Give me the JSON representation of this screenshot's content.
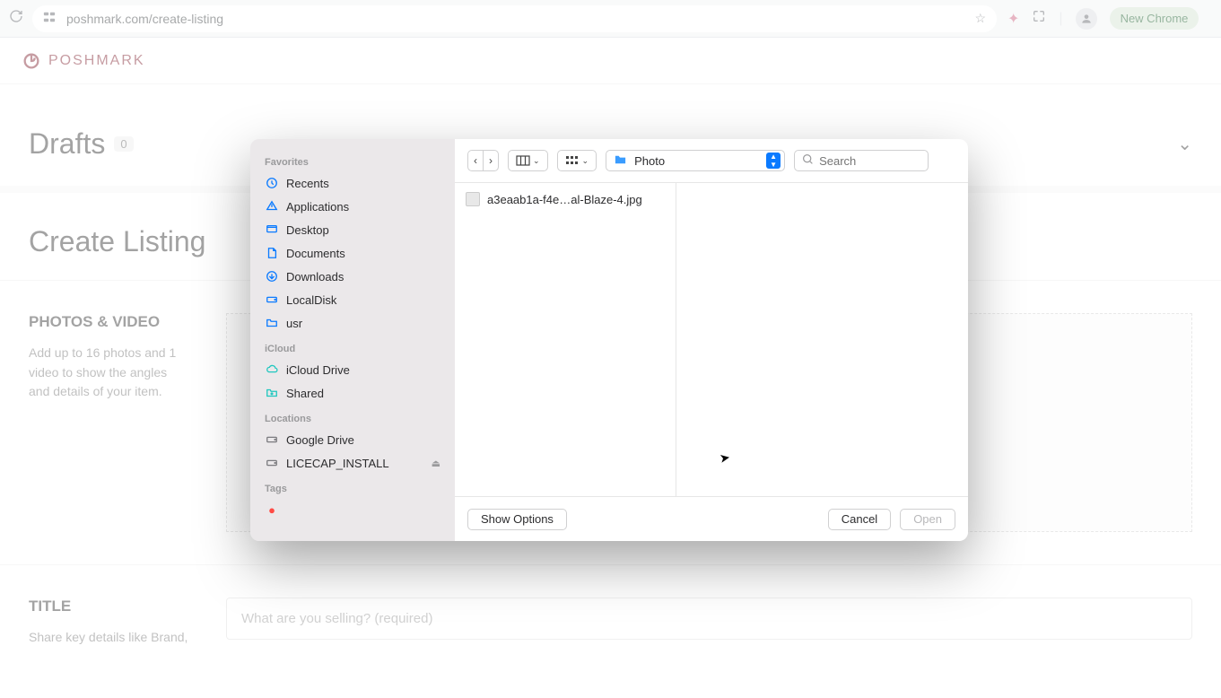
{
  "browser": {
    "url": "poshmark.com/create-listing",
    "new_chrome_label": "New Chrome"
  },
  "logo_text": "POSHMARK",
  "drafts": {
    "title": "Drafts",
    "count": "0"
  },
  "create_listing_title": "Create Listing",
  "photos": {
    "heading": "PHOTOS & VIDEO",
    "desc": "Add up to 16 photos and 1 video to show the angles and details of your item."
  },
  "title_section": {
    "heading": "TITLE",
    "desc": "Share key details like Brand,",
    "placeholder": "What are you selling? (required)"
  },
  "dialog": {
    "sidebar": {
      "groups": [
        {
          "title": "Favorites",
          "items": [
            {
              "icon": "clock",
              "label": "Recents",
              "color": "ic-blue"
            },
            {
              "icon": "A",
              "label": "Applications",
              "color": "ic-blue"
            },
            {
              "icon": "desktop",
              "label": "Desktop",
              "color": "ic-blue"
            },
            {
              "icon": "doc",
              "label": "Documents",
              "color": "ic-blue"
            },
            {
              "icon": "down",
              "label": "Downloads",
              "color": "ic-blue"
            },
            {
              "icon": "disk",
              "label": "LocalDisk",
              "color": "ic-blue"
            },
            {
              "icon": "folder",
              "label": "usr",
              "color": "ic-blue"
            }
          ]
        },
        {
          "title": "iCloud",
          "items": [
            {
              "icon": "cloud",
              "label": "iCloud Drive",
              "color": "ic-teal"
            },
            {
              "icon": "shared",
              "label": "Shared",
              "color": "ic-teal"
            }
          ]
        },
        {
          "title": "Locations",
          "items": [
            {
              "icon": "disk",
              "label": "Google Drive",
              "color": "ic-gray"
            },
            {
              "icon": "disk",
              "label": "LICECAP_INSTALL",
              "color": "ic-gray",
              "eject": true
            }
          ]
        },
        {
          "title": "Tags",
          "items": [
            {
              "icon": "dot",
              "label": "",
              "color": "ic-red"
            }
          ]
        }
      ]
    },
    "folder": "Photo",
    "search_placeholder": "Search",
    "files": [
      {
        "name": "a3eaab1a-f4e…al-Blaze-4.jpg"
      }
    ],
    "footer": {
      "show_options": "Show Options",
      "cancel": "Cancel",
      "open": "Open"
    }
  }
}
